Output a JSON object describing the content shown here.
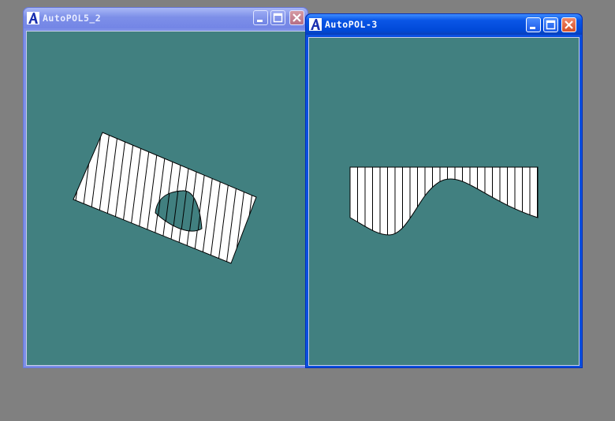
{
  "windows": [
    {
      "title": "AutoPOL5_2",
      "state": "inactive"
    },
    {
      "title": "AutoPOL-3",
      "state": "active"
    }
  ],
  "icons": {
    "app": "app-letter-a-icon",
    "minimize": "minimize-icon",
    "maximize": "maximize-icon",
    "close": "close-icon"
  },
  "colors": {
    "desktop": "#808080",
    "canvas": "#418080",
    "shape_fill": "#ffffff",
    "hatch": "#000000",
    "active_title": "#0a56e6",
    "inactive_title": "#7d8fe8"
  }
}
